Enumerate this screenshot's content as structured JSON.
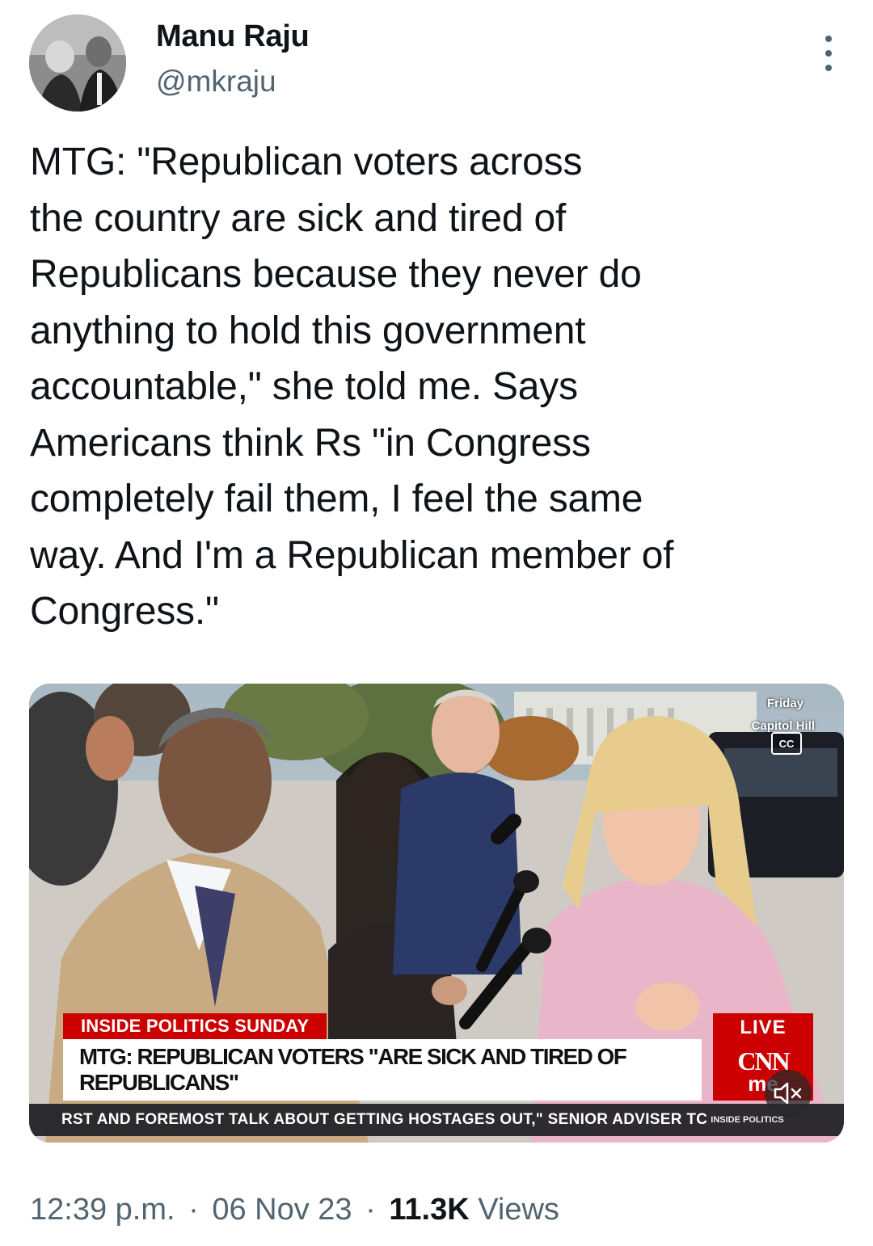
{
  "author": {
    "name": "Manu Raju",
    "handle": "@mkraju"
  },
  "tweet": {
    "text": "MTG: \"Republican voters across\nthe country are sick and tired of\nRepublicans because they never do\nanything to hold this government\naccountable,\" she told me. Says\nAmericans think Rs \"in Congress\ncompletely fail them, I feel the same\nway. And I'm a Republican member of\nCongress.\""
  },
  "video": {
    "date_tag": "Friday",
    "location_tag": "Capitol Hill",
    "cc_label": "CC",
    "show_label": "INSIDE POLITICS SUNDAY",
    "headline": "MTG: REPUBLICAN VOTERS \"ARE SICK AND TIRED OF REPUBLICANS\"",
    "live_label": "LIVE",
    "network_logo": "CNN",
    "network_sub": "me",
    "ticker": "RST AND FOREMOST TALK ABOUT GETTING HOSTAGES OUT,\" SENIOR ADVISER TC",
    "ticker_brand": "INSIDE POLITICS",
    "mute_icon": "speaker-muted-icon"
  },
  "meta": {
    "time": "12:39 p.m.",
    "separator": "·",
    "date": "06 Nov 23",
    "views_count": "11.3K",
    "views_label": "Views"
  },
  "colors": {
    "text_primary": "#0f1419",
    "text_secondary": "#536471",
    "cnn_red": "#cc0000"
  }
}
